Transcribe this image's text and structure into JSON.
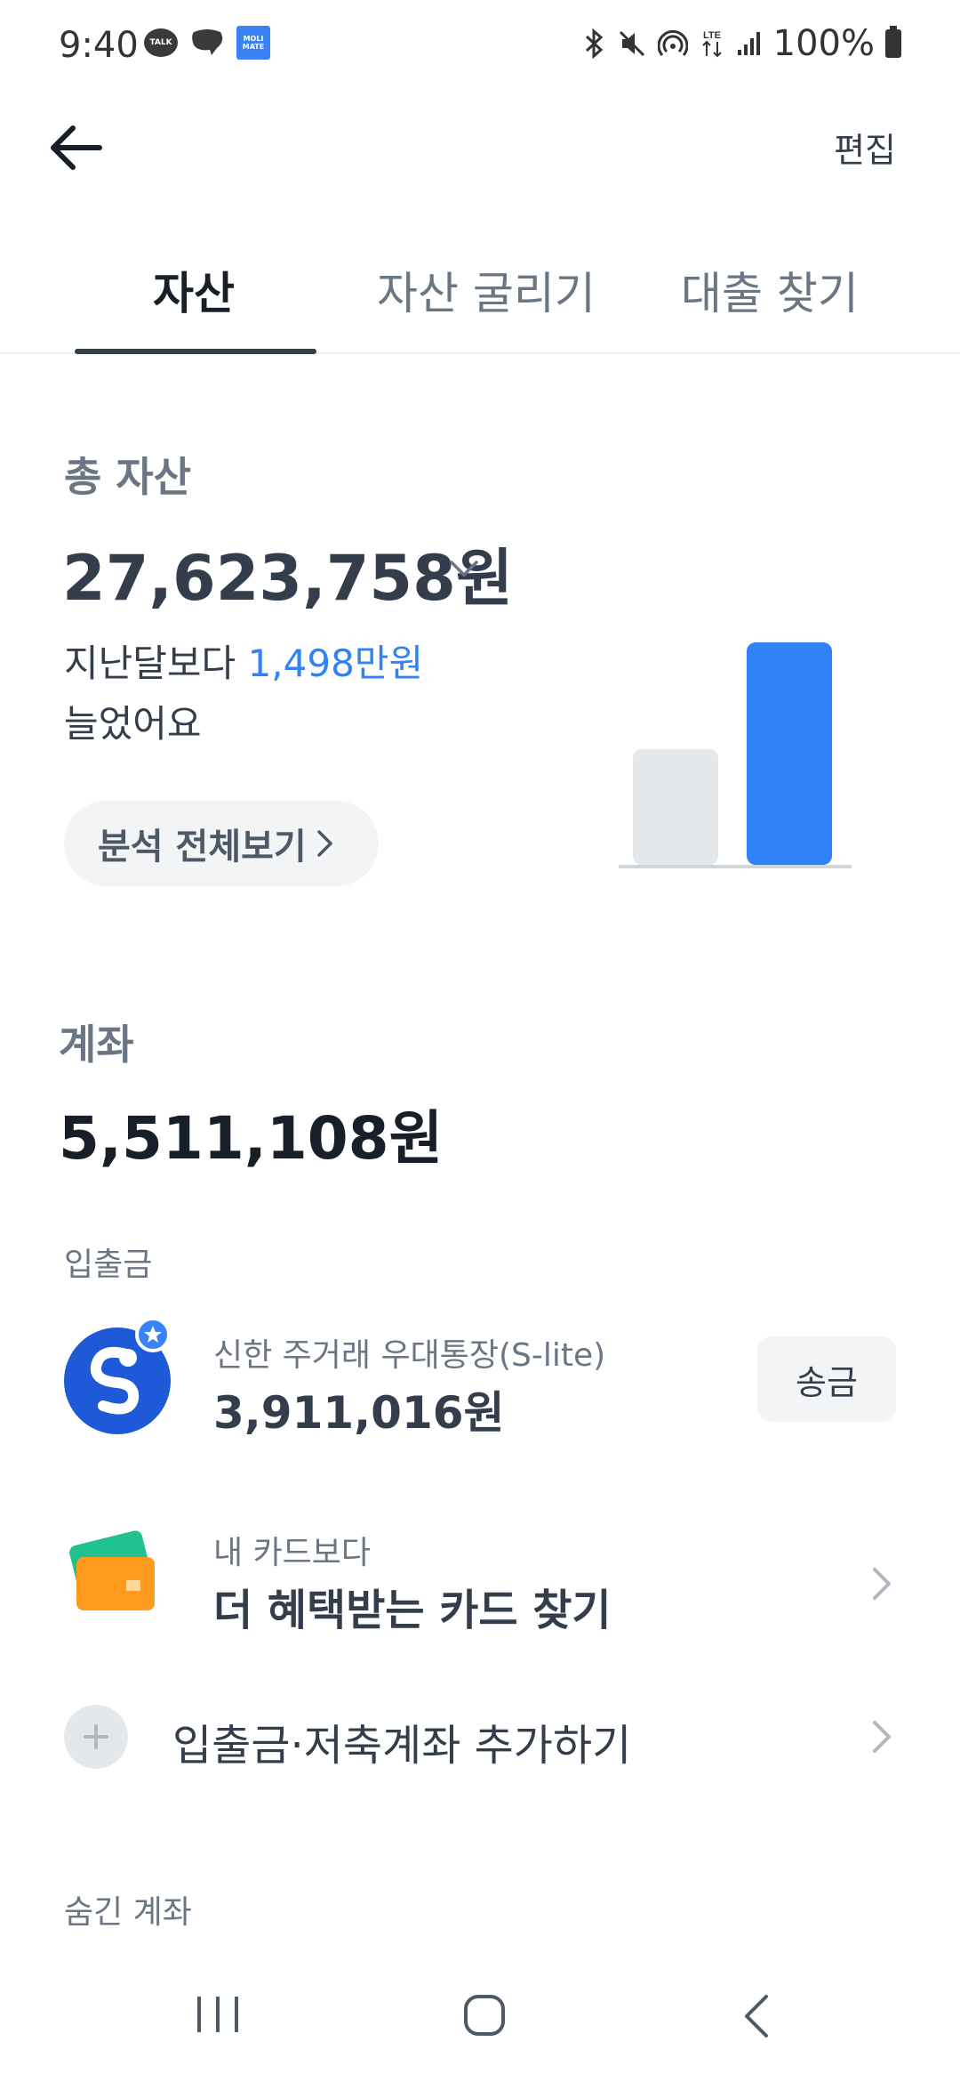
{
  "status_bar": {
    "time": "9:40",
    "notifications": [
      {
        "icon": "kakaotalk-icon",
        "text": "TALK"
      },
      {
        "icon": "chat-bubble-icon"
      },
      {
        "icon": "molimate-icon",
        "text": "MOLI MATE"
      }
    ],
    "system_icons": [
      "bluetooth-icon",
      "mute-icon",
      "hotspot-icon",
      "lte-icon",
      "signal-icon"
    ],
    "lte_label": "LTE",
    "battery": "100%"
  },
  "header": {
    "back_icon": "arrow-left-icon",
    "edit_label": "편집"
  },
  "tabs": [
    {
      "label": "자산",
      "active": true
    },
    {
      "label": "자산 굴리기",
      "active": false
    },
    {
      "label": "대출 찾기",
      "active": false
    }
  ],
  "total_assets": {
    "label": "총 자산",
    "value": "27,623,758원",
    "compare_prefix": "지난달보다",
    "compare_amount": "1,498만원",
    "compare_suffix": "늘었어요",
    "analysis_button": "분석 전체보기"
  },
  "chart_data": {
    "type": "bar",
    "categories": [
      "",
      ""
    ],
    "values": [
      52,
      100
    ],
    "ylim": [
      0,
      100
    ],
    "colors": [
      "#e5e8eb",
      "#3182f6"
    ]
  },
  "accounts": {
    "label": "계좌",
    "value": "5,511,108원",
    "section_deposit": "입출금",
    "items": [
      {
        "bank_icon": "shinhan-bank-icon",
        "name": "신한 주거래 우대통장(S-lite)",
        "amount": "3,911,016원",
        "action": "송금"
      }
    ],
    "card_promo": {
      "subtitle": "내 카드보다",
      "title": "더 혜택받는 카드 찾기"
    },
    "add_account": "입출금·저축계좌 추가하기",
    "hidden_section": "숨긴 계좌"
  },
  "colors": {
    "accent": "#3182f6",
    "text_primary": "#191f28",
    "text_secondary": "#6b7684",
    "button_bg": "#f2f4f6"
  }
}
